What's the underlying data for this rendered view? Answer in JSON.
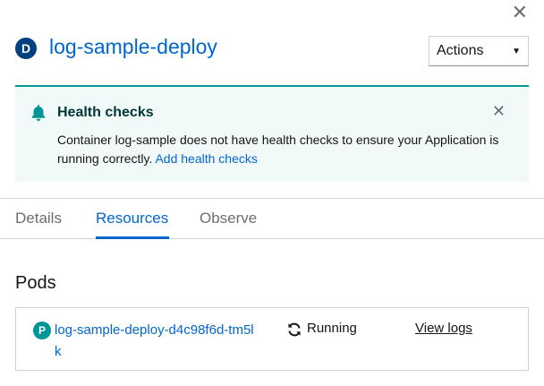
{
  "panel": {
    "close_icon": "close-icon",
    "resource_badge": "D",
    "resource_name": "log-sample-deploy",
    "actions_label": "Actions"
  },
  "alert": {
    "icon": "bell-icon",
    "title": "Health checks",
    "message": "Container log-sample does not have health checks to ensure your Application is running correctly.",
    "link_label": "Add health checks",
    "accent_color": "#009596"
  },
  "tabs": [
    {
      "label": "Details",
      "active": false
    },
    {
      "label": "Resources",
      "active": true
    },
    {
      "label": "Observe",
      "active": false
    }
  ],
  "pods": {
    "section_title": "Pods",
    "items": [
      {
        "badge": "P",
        "name": "log-sample-deploy-d4c98f6d-tm5lk",
        "status_icon": "sync-icon",
        "status": "Running",
        "logs_label": "View logs"
      }
    ]
  },
  "colors": {
    "link": "#0066cc",
    "deployment_badge": "#004080",
    "pod_badge": "#009596"
  }
}
